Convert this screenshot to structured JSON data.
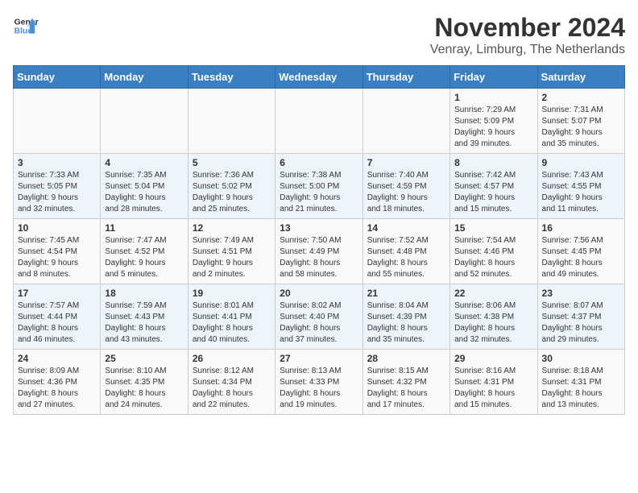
{
  "logo": {
    "line1": "General",
    "line2": "Blue"
  },
  "title": "November 2024",
  "subtitle": "Venray, Limburg, The Netherlands",
  "days_of_week": [
    "Sunday",
    "Monday",
    "Tuesday",
    "Wednesday",
    "Thursday",
    "Friday",
    "Saturday"
  ],
  "weeks": [
    [
      {
        "day": "",
        "info": ""
      },
      {
        "day": "",
        "info": ""
      },
      {
        "day": "",
        "info": ""
      },
      {
        "day": "",
        "info": ""
      },
      {
        "day": "",
        "info": ""
      },
      {
        "day": "1",
        "info": "Sunrise: 7:29 AM\nSunset: 5:09 PM\nDaylight: 9 hours\nand 39 minutes."
      },
      {
        "day": "2",
        "info": "Sunrise: 7:31 AM\nSunset: 5:07 PM\nDaylight: 9 hours\nand 35 minutes."
      }
    ],
    [
      {
        "day": "3",
        "info": "Sunrise: 7:33 AM\nSunset: 5:05 PM\nDaylight: 9 hours\nand 32 minutes."
      },
      {
        "day": "4",
        "info": "Sunrise: 7:35 AM\nSunset: 5:04 PM\nDaylight: 9 hours\nand 28 minutes."
      },
      {
        "day": "5",
        "info": "Sunrise: 7:36 AM\nSunset: 5:02 PM\nDaylight: 9 hours\nand 25 minutes."
      },
      {
        "day": "6",
        "info": "Sunrise: 7:38 AM\nSunset: 5:00 PM\nDaylight: 9 hours\nand 21 minutes."
      },
      {
        "day": "7",
        "info": "Sunrise: 7:40 AM\nSunset: 4:59 PM\nDaylight: 9 hours\nand 18 minutes."
      },
      {
        "day": "8",
        "info": "Sunrise: 7:42 AM\nSunset: 4:57 PM\nDaylight: 9 hours\nand 15 minutes."
      },
      {
        "day": "9",
        "info": "Sunrise: 7:43 AM\nSunset: 4:55 PM\nDaylight: 9 hours\nand 11 minutes."
      }
    ],
    [
      {
        "day": "10",
        "info": "Sunrise: 7:45 AM\nSunset: 4:54 PM\nDaylight: 9 hours\nand 8 minutes."
      },
      {
        "day": "11",
        "info": "Sunrise: 7:47 AM\nSunset: 4:52 PM\nDaylight: 9 hours\nand 5 minutes."
      },
      {
        "day": "12",
        "info": "Sunrise: 7:49 AM\nSunset: 4:51 PM\nDaylight: 9 hours\nand 2 minutes."
      },
      {
        "day": "13",
        "info": "Sunrise: 7:50 AM\nSunset: 4:49 PM\nDaylight: 8 hours\nand 58 minutes."
      },
      {
        "day": "14",
        "info": "Sunrise: 7:52 AM\nSunset: 4:48 PM\nDaylight: 8 hours\nand 55 minutes."
      },
      {
        "day": "15",
        "info": "Sunrise: 7:54 AM\nSunset: 4:46 PM\nDaylight: 8 hours\nand 52 minutes."
      },
      {
        "day": "16",
        "info": "Sunrise: 7:56 AM\nSunset: 4:45 PM\nDaylight: 8 hours\nand 49 minutes."
      }
    ],
    [
      {
        "day": "17",
        "info": "Sunrise: 7:57 AM\nSunset: 4:44 PM\nDaylight: 8 hours\nand 46 minutes."
      },
      {
        "day": "18",
        "info": "Sunrise: 7:59 AM\nSunset: 4:43 PM\nDaylight: 8 hours\nand 43 minutes."
      },
      {
        "day": "19",
        "info": "Sunrise: 8:01 AM\nSunset: 4:41 PM\nDaylight: 8 hours\nand 40 minutes."
      },
      {
        "day": "20",
        "info": "Sunrise: 8:02 AM\nSunset: 4:40 PM\nDaylight: 8 hours\nand 37 minutes."
      },
      {
        "day": "21",
        "info": "Sunrise: 8:04 AM\nSunset: 4:39 PM\nDaylight: 8 hours\nand 35 minutes."
      },
      {
        "day": "22",
        "info": "Sunrise: 8:06 AM\nSunset: 4:38 PM\nDaylight: 8 hours\nand 32 minutes."
      },
      {
        "day": "23",
        "info": "Sunrise: 8:07 AM\nSunset: 4:37 PM\nDaylight: 8 hours\nand 29 minutes."
      }
    ],
    [
      {
        "day": "24",
        "info": "Sunrise: 8:09 AM\nSunset: 4:36 PM\nDaylight: 8 hours\nand 27 minutes."
      },
      {
        "day": "25",
        "info": "Sunrise: 8:10 AM\nSunset: 4:35 PM\nDaylight: 8 hours\nand 24 minutes."
      },
      {
        "day": "26",
        "info": "Sunrise: 8:12 AM\nSunset: 4:34 PM\nDaylight: 8 hours\nand 22 minutes."
      },
      {
        "day": "27",
        "info": "Sunrise: 8:13 AM\nSunset: 4:33 PM\nDaylight: 8 hours\nand 19 minutes."
      },
      {
        "day": "28",
        "info": "Sunrise: 8:15 AM\nSunset: 4:32 PM\nDaylight: 8 hours\nand 17 minutes."
      },
      {
        "day": "29",
        "info": "Sunrise: 8:16 AM\nSunset: 4:31 PM\nDaylight: 8 hours\nand 15 minutes."
      },
      {
        "day": "30",
        "info": "Sunrise: 8:18 AM\nSunset: 4:31 PM\nDaylight: 8 hours\nand 13 minutes."
      }
    ]
  ]
}
